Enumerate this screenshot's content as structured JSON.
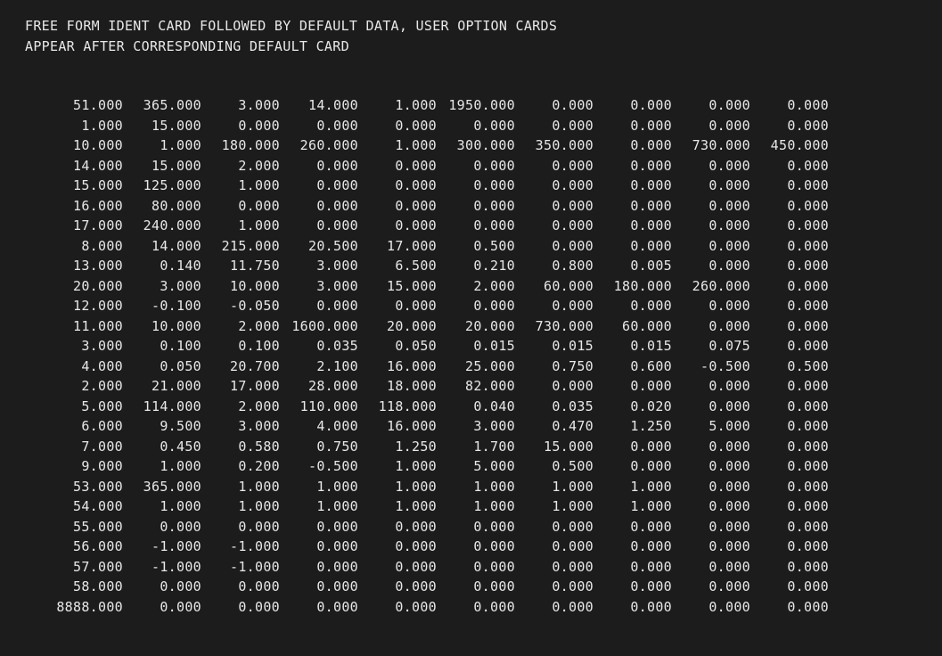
{
  "header": {
    "line1": "FREE FORM IDENT CARD FOLLOWED BY DEFAULT DATA, USER OPTION CARDS",
    "line2": "APPEAR AFTER CORRESPONDING DEFAULT CARD"
  },
  "table": {
    "rows": [
      [
        "51.000",
        "365.000",
        "3.000",
        "14.000",
        "1.000",
        "1950.000",
        "0.000",
        "0.000",
        "0.000",
        "0.000"
      ],
      [
        "1.000",
        "15.000",
        "0.000",
        "0.000",
        "0.000",
        "0.000",
        "0.000",
        "0.000",
        "0.000",
        "0.000"
      ],
      [
        "10.000",
        "1.000",
        "180.000",
        "260.000",
        "1.000",
        "300.000",
        "350.000",
        "0.000",
        "730.000",
        "450.000"
      ],
      [
        "14.000",
        "15.000",
        "2.000",
        "0.000",
        "0.000",
        "0.000",
        "0.000",
        "0.000",
        "0.000",
        "0.000"
      ],
      [
        "15.000",
        "125.000",
        "1.000",
        "0.000",
        "0.000",
        "0.000",
        "0.000",
        "0.000",
        "0.000",
        "0.000"
      ],
      [
        "16.000",
        "80.000",
        "0.000",
        "0.000",
        "0.000",
        "0.000",
        "0.000",
        "0.000",
        "0.000",
        "0.000"
      ],
      [
        "17.000",
        "240.000",
        "1.000",
        "0.000",
        "0.000",
        "0.000",
        "0.000",
        "0.000",
        "0.000",
        "0.000"
      ],
      [
        "8.000",
        "14.000",
        "215.000",
        "20.500",
        "17.000",
        "0.500",
        "0.000",
        "0.000",
        "0.000",
        "0.000"
      ],
      [
        "13.000",
        "0.140",
        "11.750",
        "3.000",
        "6.500",
        "0.210",
        "0.800",
        "0.005",
        "0.000",
        "0.000"
      ],
      [
        "20.000",
        "3.000",
        "10.000",
        "3.000",
        "15.000",
        "2.000",
        "60.000",
        "180.000",
        "260.000",
        "0.000"
      ],
      [
        "12.000",
        "-0.100",
        "-0.050",
        "0.000",
        "0.000",
        "0.000",
        "0.000",
        "0.000",
        "0.000",
        "0.000"
      ],
      [
        "11.000",
        "10.000",
        "2.000",
        "1600.000",
        "20.000",
        "20.000",
        "730.000",
        "60.000",
        "0.000",
        "0.000"
      ],
      [
        "3.000",
        "0.100",
        "0.100",
        "0.035",
        "0.050",
        "0.015",
        "0.015",
        "0.015",
        "0.075",
        "0.000"
      ],
      [
        "4.000",
        "0.050",
        "20.700",
        "2.100",
        "16.000",
        "25.000",
        "0.750",
        "0.600",
        "-0.500",
        "0.500"
      ],
      [
        "2.000",
        "21.000",
        "17.000",
        "28.000",
        "18.000",
        "82.000",
        "0.000",
        "0.000",
        "0.000",
        "0.000"
      ],
      [
        "5.000",
        "114.000",
        "2.000",
        "110.000",
        "118.000",
        "0.040",
        "0.035",
        "0.020",
        "0.000",
        "0.000"
      ],
      [
        "6.000",
        "9.500",
        "3.000",
        "4.000",
        "16.000",
        "3.000",
        "0.470",
        "1.250",
        "5.000",
        "0.000"
      ],
      [
        "7.000",
        "0.450",
        "0.580",
        "0.750",
        "1.250",
        "1.700",
        "15.000",
        "0.000",
        "0.000",
        "0.000"
      ],
      [
        "9.000",
        "1.000",
        "0.200",
        "-0.500",
        "1.000",
        "5.000",
        "0.500",
        "0.000",
        "0.000",
        "0.000"
      ],
      [
        "53.000",
        "365.000",
        "1.000",
        "1.000",
        "1.000",
        "1.000",
        "1.000",
        "1.000",
        "0.000",
        "0.000"
      ],
      [
        "54.000",
        "1.000",
        "1.000",
        "1.000",
        "1.000",
        "1.000",
        "1.000",
        "1.000",
        "0.000",
        "0.000"
      ],
      [
        "55.000",
        "0.000",
        "0.000",
        "0.000",
        "0.000",
        "0.000",
        "0.000",
        "0.000",
        "0.000",
        "0.000"
      ],
      [
        "56.000",
        "-1.000",
        "-1.000",
        "0.000",
        "0.000",
        "0.000",
        "0.000",
        "0.000",
        "0.000",
        "0.000"
      ],
      [
        "57.000",
        "-1.000",
        "-1.000",
        "0.000",
        "0.000",
        "0.000",
        "0.000",
        "0.000",
        "0.000",
        "0.000"
      ],
      [
        "58.000",
        "0.000",
        "0.000",
        "0.000",
        "0.000",
        "0.000",
        "0.000",
        "0.000",
        "0.000",
        "0.000"
      ],
      [
        "8888.000",
        "0.000",
        "0.000",
        "0.000",
        "0.000",
        "0.000",
        "0.000",
        "0.000",
        "0.000",
        "0.000"
      ]
    ]
  }
}
